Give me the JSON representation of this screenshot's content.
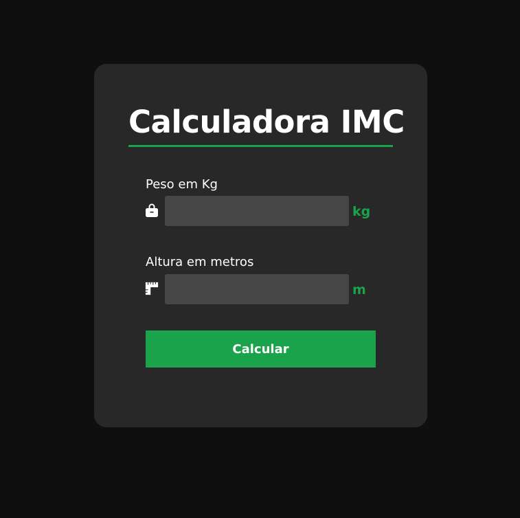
{
  "card": {
    "title": "Calculadora IMC"
  },
  "fields": {
    "weight": {
      "label": "Peso em Kg",
      "value": "",
      "placeholder": "",
      "unit": "kg",
      "icon": "weight-bag-icon"
    },
    "height": {
      "label": "Altura em metros",
      "value": "",
      "placeholder": "",
      "unit": "m",
      "icon": "ruler-icon"
    }
  },
  "button": {
    "label": "Calcular"
  },
  "colors": {
    "page_background": "#0f0f0f",
    "card_background": "#282828",
    "input_background": "#474747",
    "accent": "#1aa34a",
    "text": "#ffffff"
  }
}
